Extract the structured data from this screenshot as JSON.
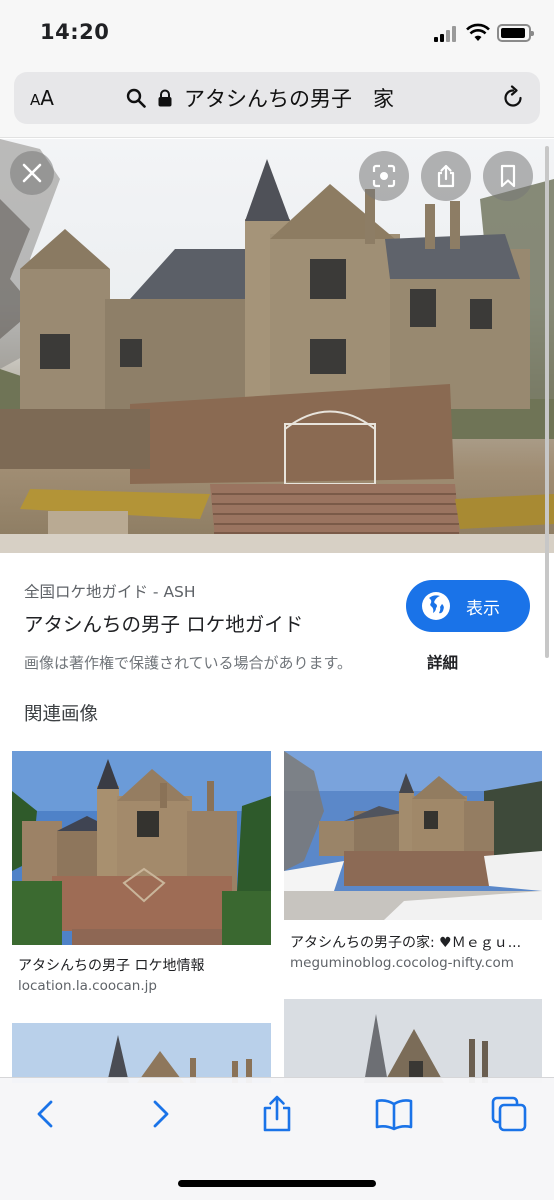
{
  "status_bar": {
    "time": "14:20"
  },
  "address_bar": {
    "text_size_label_small": "A",
    "text_size_label_large": "A",
    "url_text": "アタシんちの男子　家"
  },
  "hero": {
    "icons": [
      "close-icon",
      "lens-icon",
      "share-icon",
      "bookmark-icon"
    ]
  },
  "result": {
    "source": "全国ロケ地ガイド - ASH",
    "title": "アタシんちの男子 ロケ地ガイド",
    "visit_label": "表示",
    "copyright_note": "画像は著作権で保護されている場合があります。",
    "details_label": "詳細"
  },
  "related": {
    "heading": "関連画像",
    "items": [
      {
        "caption": "アタシんちの男子 ロケ地情報",
        "domain": "location.la.coocan.jp"
      },
      {
        "caption": "アタシんちの男子の家: ♥Ｍｅｇｕ...",
        "domain": "meguminoblog.cocolog-nifty.com"
      }
    ]
  },
  "toolbar": {
    "icons": [
      "back-icon",
      "forward-icon",
      "share-icon",
      "bookmarks-icon",
      "tabs-icon"
    ]
  }
}
